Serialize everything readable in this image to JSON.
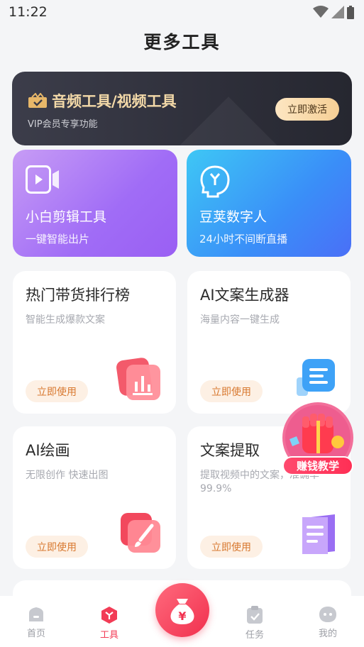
{
  "status": {
    "time": "11:22"
  },
  "page": {
    "title": "更多工具"
  },
  "banner": {
    "title": "音频工具/视频工具",
    "subtitle": "VIP会员专享功能",
    "button": "立即激活",
    "icon": "crown-tag-icon"
  },
  "features": [
    {
      "title": "小白剪辑工具",
      "subtitle": "一键智能出片",
      "icon": "video-camera-icon"
    },
    {
      "title": "豆荚数字人",
      "subtitle": "24小时不间断直播",
      "icon": "digital-human-head-icon"
    }
  ],
  "cards": [
    {
      "title": "热门带货排行榜",
      "subtitle": "智能生成爆款文案",
      "button": "立即使用",
      "icon": "bar-chart-icon"
    },
    {
      "title": "AI文案生成器",
      "subtitle": "海量内容一键生成",
      "button": "立即使用",
      "icon": "document-text-icon"
    },
    {
      "title": "AI绘画",
      "subtitle": "无限创作 快速出图",
      "button": "立即使用",
      "icon": "paint-brush-icon"
    },
    {
      "title": "文案提取",
      "subtitle": "提取视频中的文案，准确率99.9%",
      "button": "立即使用",
      "icon": "text-extract-icon"
    }
  ],
  "promo": {
    "label": "赚钱教学",
    "icon": "gift-hand-icon"
  },
  "tabs": [
    {
      "label": "首页",
      "icon": "home-icon"
    },
    {
      "label": "工具",
      "icon": "tools-cube-icon"
    },
    {
      "label": "任务",
      "icon": "clipboard-check-icon"
    },
    {
      "label": "我的",
      "icon": "profile-face-icon"
    }
  ],
  "center_tab": {
    "icon": "money-bag-icon",
    "glyph": "¥"
  },
  "colors": {
    "accent": "#f23c56",
    "banner_gold": "#f3d9a8",
    "button_orange": "#d8782f"
  }
}
